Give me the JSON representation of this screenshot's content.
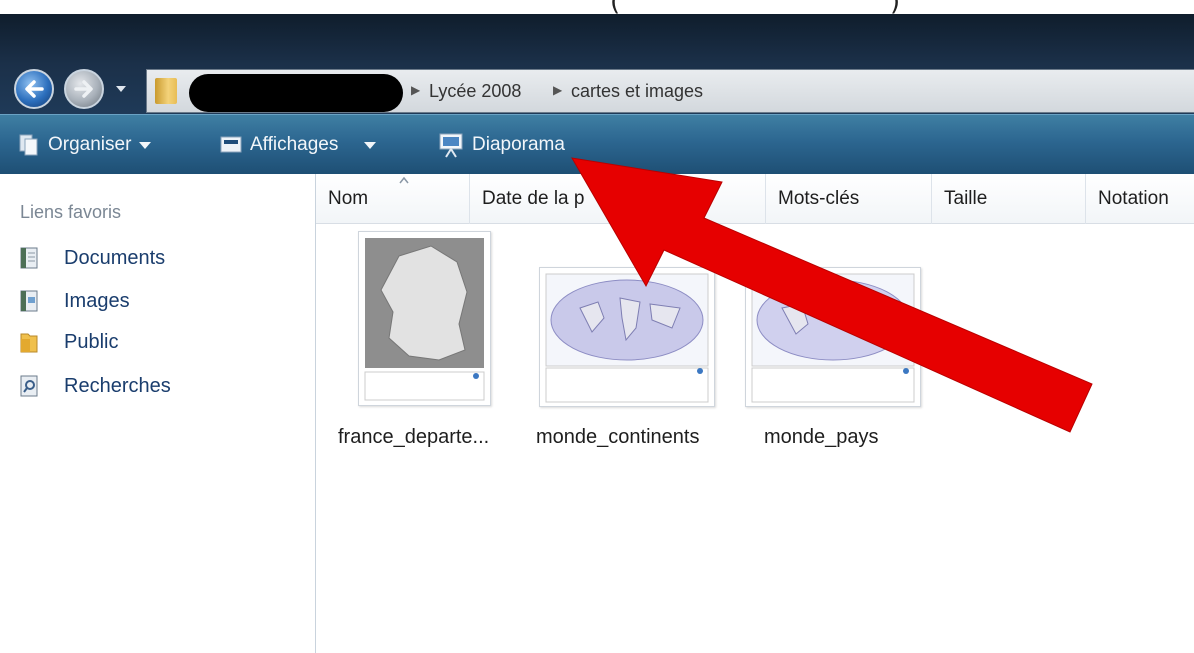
{
  "top_strip": {
    "paren_left": "(",
    "paren_right": ")"
  },
  "address_bar": {
    "breadcrumbs": [
      "Lycée 2008",
      "cartes et images"
    ],
    "separator": "▶"
  },
  "toolbar": {
    "organize_label": "Organiser",
    "views_label": "Affichages",
    "slideshow_label": "Diaporama"
  },
  "sidebar": {
    "heading": "Liens favoris",
    "items": [
      {
        "label": "Documents",
        "icon": "documents-icon"
      },
      {
        "label": "Images",
        "icon": "pictures-icon"
      },
      {
        "label": "Public",
        "icon": "folder-icon"
      },
      {
        "label": "Recherches",
        "icon": "searches-icon"
      }
    ]
  },
  "columns": [
    {
      "label": "Nom"
    },
    {
      "label": "Date de la p"
    },
    {
      "label": "Mots-clés"
    },
    {
      "label": "Taille"
    },
    {
      "label": "Notation"
    }
  ],
  "files": [
    {
      "name": "france_departe..."
    },
    {
      "name": "monde_continents"
    },
    {
      "name": "monde_pays"
    }
  ],
  "colors": {
    "annotation_arrow": "#e60000",
    "toolbar": "#2c6690",
    "link": "#1a3d6d"
  }
}
